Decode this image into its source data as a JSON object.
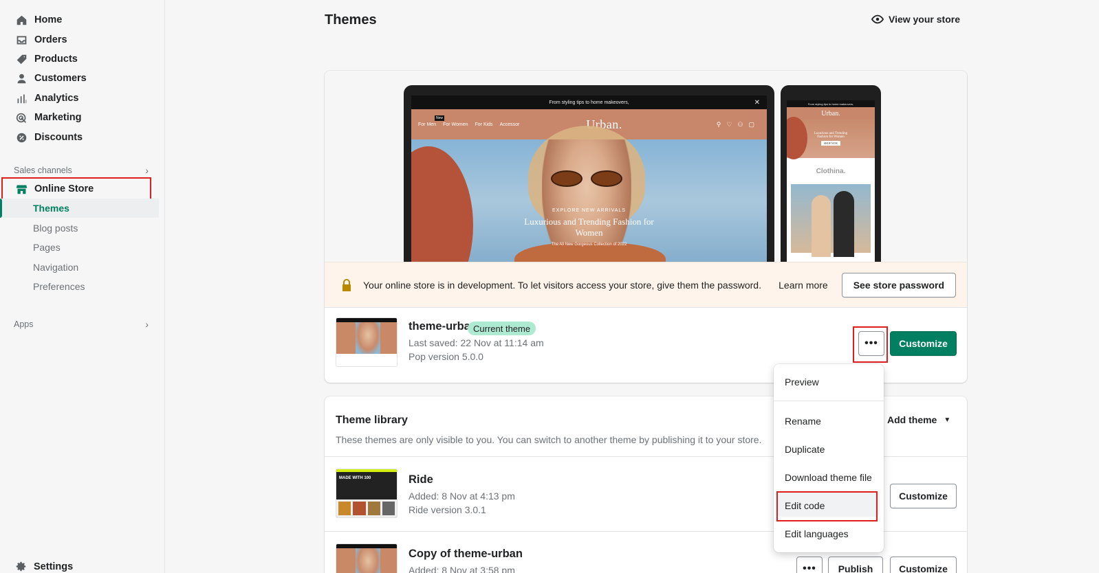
{
  "sidebar": {
    "items": [
      {
        "label": "Home",
        "icon": "home-icon"
      },
      {
        "label": "Orders",
        "icon": "inbox-icon"
      },
      {
        "label": "Products",
        "icon": "tag-icon"
      },
      {
        "label": "Customers",
        "icon": "person-icon"
      },
      {
        "label": "Analytics",
        "icon": "bar-chart-icon"
      },
      {
        "label": "Marketing",
        "icon": "target-icon"
      },
      {
        "label": "Discounts",
        "icon": "discount-icon"
      }
    ],
    "sales_channels_label": "Sales channels",
    "online_store": {
      "label": "Online Store",
      "icon": "store-icon"
    },
    "sub_items": [
      "Themes",
      "Blog posts",
      "Pages",
      "Navigation",
      "Preferences"
    ],
    "apps_label": "Apps",
    "settings_label": "Settings"
  },
  "header": {
    "title": "Themes",
    "view_store": "View your store"
  },
  "preview": {
    "desktop_announcement": "From styling tips to home makeovers,",
    "desktop_nav": [
      "For Men",
      "For Women",
      "For Kids",
      "Accessor"
    ],
    "new_tag": "New",
    "brand": "Urban.",
    "hero_kicker": "EXPLORE NEW ARRIVALS",
    "hero_headline_1": "Luxurious and Trending Fashion for",
    "hero_headline_2": "Women",
    "hero_tagline": "The All New Gorgeous Collection of 2022",
    "mobile_announcement": "From styling tips to home makeovers,",
    "mobile_brand": "Urban.",
    "mobile_hero_1": "Luxurious and Trending",
    "mobile_hero_2": "Fashion for Women",
    "mobile_hero_button": "SHOP NOW",
    "mobile_section": "Clothina."
  },
  "banner": {
    "message": "Your online store is in development. To let visitors access your store, give them the password.",
    "learn_more": "Learn more",
    "button": "See store password"
  },
  "current_theme": {
    "name": "theme-urban",
    "badge": "Current theme",
    "saved": "Last saved: 22 Nov at 11:14 am",
    "version": "Pop version 5.0.0",
    "more": "•••",
    "customize": "Customize"
  },
  "dropdown": {
    "items": [
      "Preview",
      "Rename",
      "Duplicate",
      "Download theme file",
      "Edit code",
      "Edit languages"
    ]
  },
  "library": {
    "title": "Theme library",
    "description": "These themes are only visible to you. You can switch to another theme by publishing it to your store.",
    "add_theme": "Add theme",
    "themes": [
      {
        "name": "Ride",
        "added": "Added: 8 Nov at 4:13 pm",
        "version": "Ride version 3.0.1",
        "customize": "Customize"
      },
      {
        "name": "Copy of theme-urban",
        "added": "Added: 8 Nov at 3:58 pm",
        "more": "•••",
        "publish": "Publish",
        "customize": "Customize"
      }
    ],
    "ride_thumb_text": "MADE WITH 100"
  },
  "colors": {
    "accent": "#008060",
    "highlight": "#e01d1d",
    "badge": "#aee9d1",
    "banner": "#fff4eb"
  }
}
